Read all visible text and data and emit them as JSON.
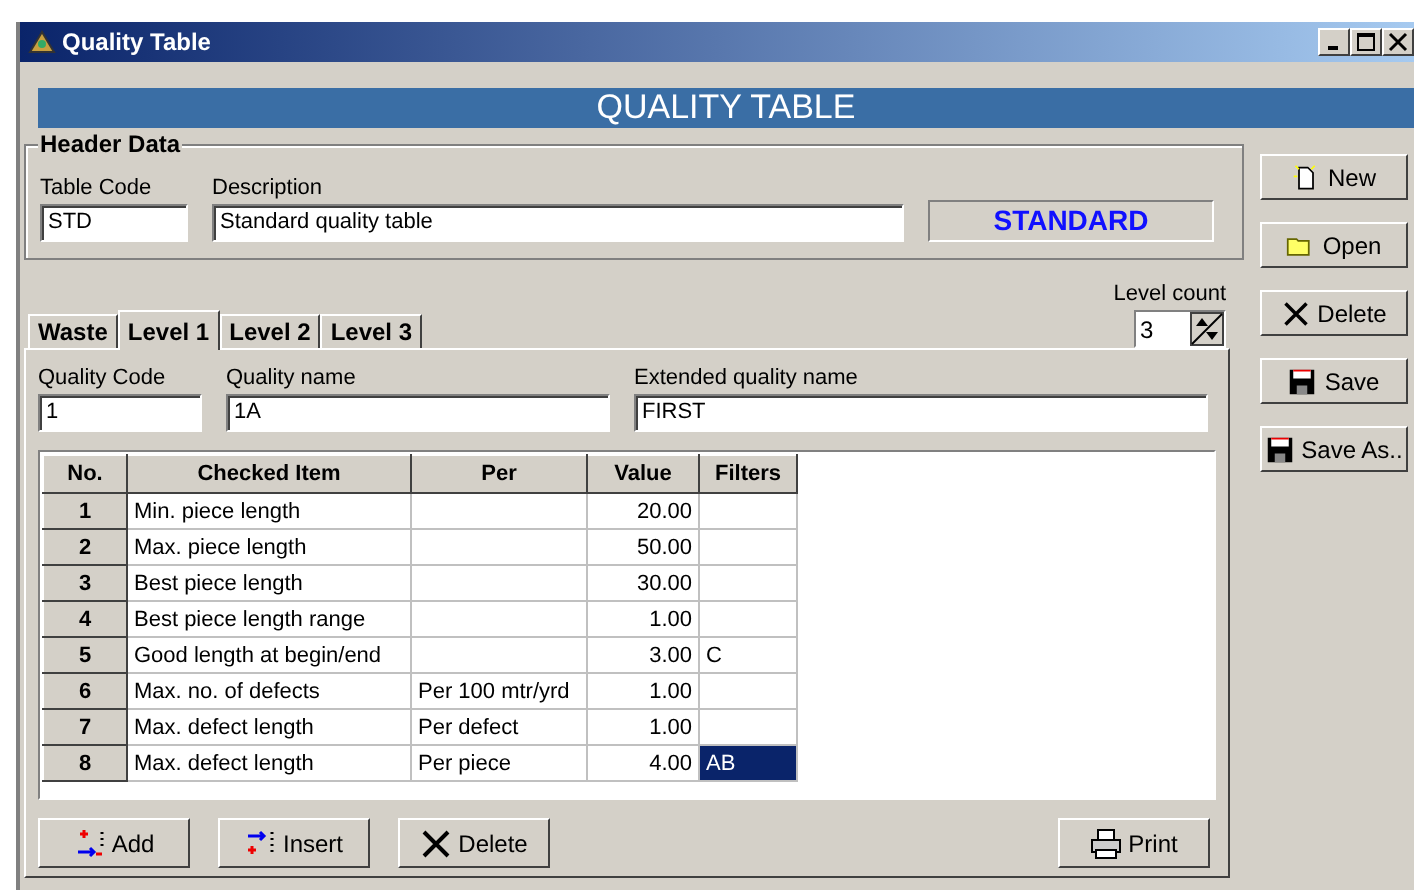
{
  "window": {
    "title": "Quality Table"
  },
  "banner": "QUALITY TABLE",
  "header_data": {
    "title": "Header Data",
    "table_code": {
      "label": "Table Code",
      "value": "STD"
    },
    "description": {
      "label": "Description",
      "value": "Standard quality table"
    },
    "badge": "STANDARD"
  },
  "side_buttons": [
    {
      "kind": "new",
      "label": "New"
    },
    {
      "kind": "open",
      "label": "Open"
    },
    {
      "kind": "delete",
      "label": "Delete"
    },
    {
      "kind": "save",
      "label": "Save"
    },
    {
      "kind": "save",
      "label": "Save As.."
    }
  ],
  "level_count": {
    "label": "Level count",
    "value": "3"
  },
  "tabs": [
    {
      "label": "Waste",
      "selected": false
    },
    {
      "label": "Level 1",
      "selected": true
    },
    {
      "label": "Level 2",
      "selected": false
    },
    {
      "label": "Level 3",
      "selected": false
    }
  ],
  "fields": [
    {
      "label": "Quality Code",
      "value": "1"
    },
    {
      "label": "Quality name",
      "value": "1A"
    },
    {
      "label": "Extended quality name",
      "value": "FIRST"
    }
  ],
  "table": {
    "columns": [
      "No.",
      "Checked Item",
      "Per",
      "Value",
      "Filters"
    ],
    "rows": [
      {
        "cells": [
          "1",
          "Min. piece length",
          "",
          "20.00",
          ""
        ],
        "selected": false
      },
      {
        "cells": [
          "2",
          "Max. piece length",
          "",
          "50.00",
          ""
        ],
        "selected": false
      },
      {
        "cells": [
          "3",
          "Best piece length",
          "",
          "30.00",
          ""
        ],
        "selected": false
      },
      {
        "cells": [
          "4",
          "Best piece length range",
          "",
          "1.00",
          ""
        ],
        "selected": false
      },
      {
        "cells": [
          "5",
          "Good length at begin/end",
          "",
          "3.00",
          "C"
        ],
        "selected": false
      },
      {
        "cells": [
          "6",
          "Max. no. of defects",
          "Per 100 mtr/yrd",
          "1.00",
          ""
        ],
        "selected": false
      },
      {
        "cells": [
          "7",
          "Max. defect length",
          "Per defect",
          "1.00",
          ""
        ],
        "selected": false
      },
      {
        "cells": [
          "8",
          "Max. defect length",
          "Per piece",
          "4.00",
          "AB"
        ],
        "selected": true
      }
    ]
  },
  "bottom_buttons": [
    {
      "kind": "add",
      "label": "Add"
    },
    {
      "kind": "insert",
      "label": "Insert"
    },
    {
      "kind": "delete",
      "label": "Delete"
    },
    {
      "kind": "print",
      "label": "Print"
    }
  ]
}
